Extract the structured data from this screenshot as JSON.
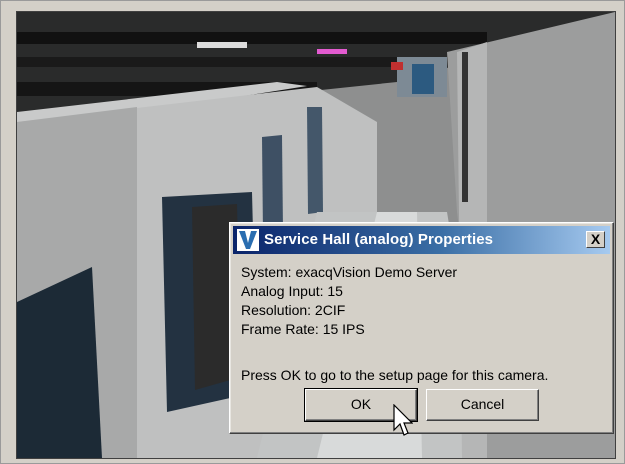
{
  "dialog": {
    "title": "Service Hall (analog) Properties",
    "close_label": "X",
    "icon": "exacqvision-logo-icon",
    "system": "System: exacqVision Demo Server",
    "analog_input": "Analog Input: 15",
    "resolution": "Resolution: 2CIF",
    "frame_rate": "Frame Rate: 15 IPS",
    "prompt": "Press OK to go to the setup page for this camera.",
    "ok_label": "OK",
    "cancel_label": "Cancel"
  },
  "colors": {
    "title_start": "#0a246a",
    "title_end": "#a6caf0",
    "dialog_bg": "#d4d0c8"
  }
}
